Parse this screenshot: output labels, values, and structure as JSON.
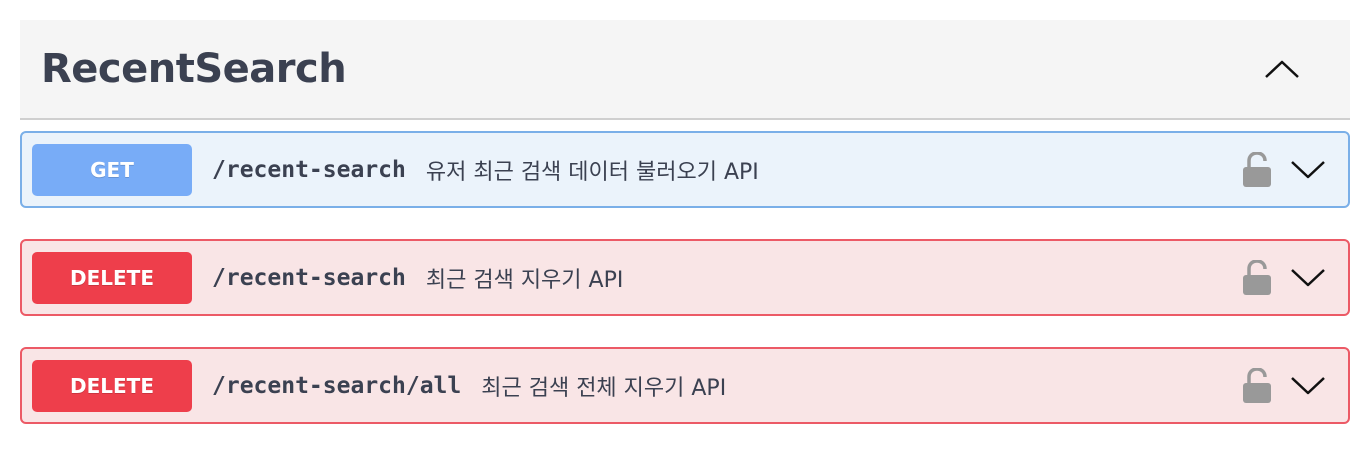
{
  "section": {
    "title": "RecentSearch",
    "expanded": true
  },
  "operations": [
    {
      "method": "GET",
      "path": "/recent-search",
      "summary": "유저 최근 검색 데이터 불러오기 API",
      "color": "#61affe"
    },
    {
      "method": "DELETE",
      "path": "/recent-search",
      "summary": "최근 검색 지우기 API",
      "color": "#f93e3e"
    },
    {
      "method": "DELETE",
      "path": "/recent-search/all",
      "summary": "최근 검색 전체 지우기 API",
      "color": "#f93e3e"
    }
  ],
  "icons": {
    "collapse": "chevron-up-icon",
    "lock": "unlocked-padlock-icon",
    "expand": "chevron-down-icon"
  }
}
